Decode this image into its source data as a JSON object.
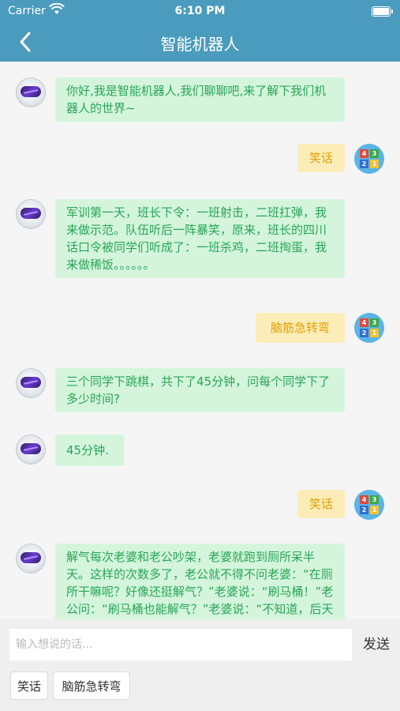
{
  "status_bar": {
    "carrier": "Carrier",
    "time": "6:10 PM"
  },
  "nav": {
    "title": "智能机器人",
    "back_icon": "chevron-left-icon"
  },
  "messages": [
    {
      "sender": "bot",
      "text": "你好,我是智能机器人,我们聊聊吧,来了解下我们机器人的世界~"
    },
    {
      "sender": "user",
      "text": "笑话"
    },
    {
      "sender": "bot",
      "text": "军训第一天，班长下令：一班射击，二班扛弹，我来做示范。队伍听后一阵暴笑，原来，班长的四川话口令被同学们听成了：一班杀鸡，二班掏蛋，我来做稀饭。。。。。。"
    },
    {
      "sender": "user",
      "text": "脑筋急转弯"
    },
    {
      "sender": "bot",
      "text": "三个同学下跳棋，共下了45分钟，问每个同学下了多少时间?"
    },
    {
      "sender": "bot",
      "text": "45分钟."
    },
    {
      "sender": "user",
      "text": "笑话"
    },
    {
      "sender": "bot",
      "text": "解气每次老婆和老公吵架，老婆就跑到厕所呆半天。这样的次数多了，老公就不得不问老婆：“在厕所干嘛呢？好像还挺解气？”老婆说：“刷马桶！”老公问：“刷马桶也能解气？”老婆说：“不知道，后天用的都是你的"
    }
  ],
  "user_avatar_digits": [
    "4",
    "3",
    "2",
    "1"
  ],
  "input": {
    "placeholder": "输入想说的话...",
    "value": ""
  },
  "send_label": "发送",
  "quick_replies": [
    "笑话",
    "脑筋急转弯"
  ],
  "colors": {
    "header": "#4a9bbd",
    "bot_bubble": "#d4f5dc",
    "bot_text": "#29a557",
    "user_bubble": "#fcecb8",
    "user_text": "#e0a200"
  }
}
